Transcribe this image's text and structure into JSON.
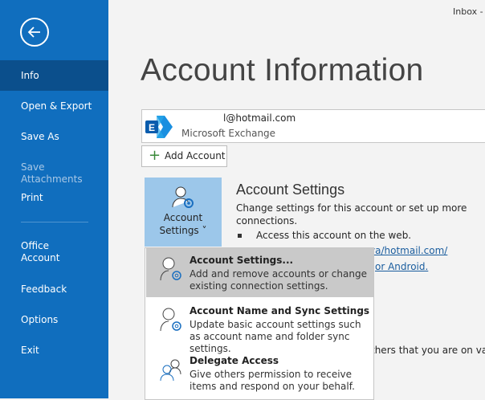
{
  "window": {
    "title_fragment": "Inbox -"
  },
  "sidebar": {
    "back_icon": "back-arrow-icon",
    "items": [
      {
        "label": "Info",
        "selected": true
      },
      {
        "label": "Open & Export"
      },
      {
        "label": "Save As"
      },
      {
        "label": "Save Attachments",
        "disabled": true
      },
      {
        "label": "Print"
      },
      {
        "label": "Office Account"
      },
      {
        "label": "Feedback"
      },
      {
        "label": "Options"
      },
      {
        "label": "Exit"
      }
    ]
  },
  "main": {
    "title": "Account Information",
    "account": {
      "email": "l@hotmail.com",
      "type": "Microsoft Exchange"
    },
    "add_account": "Add Account",
    "account_settings_button": {
      "line1": "Account",
      "line2": "Settings ˅"
    },
    "account_settings_heading": "Account Settings",
    "account_settings_desc": "Change settings for this account or set up more connections.",
    "bullet": "Access this account on the web.",
    "link1": "va/hotmail.com/",
    "link2": "or Android.",
    "vacation_fragment": "thers that you are on vacat"
  },
  "menu": {
    "items": [
      {
        "title": "Account Settings...",
        "desc": "Add and remove accounts or change existing connection settings.",
        "highlighted": true
      },
      {
        "title": "Account Name and Sync Settings",
        "desc": "Update basic account settings such as account name and folder sync settings."
      },
      {
        "title": "Delegate Access",
        "desc": "Give others permission to receive items and respond on your behalf."
      }
    ]
  },
  "colors": {
    "sidebar": "#106ebe",
    "sidebar_selected": "#0b4f8c",
    "button_highlight": "#9cc7ea",
    "menu_highlight": "#c9c9c9",
    "link": "#1a5d9e"
  }
}
